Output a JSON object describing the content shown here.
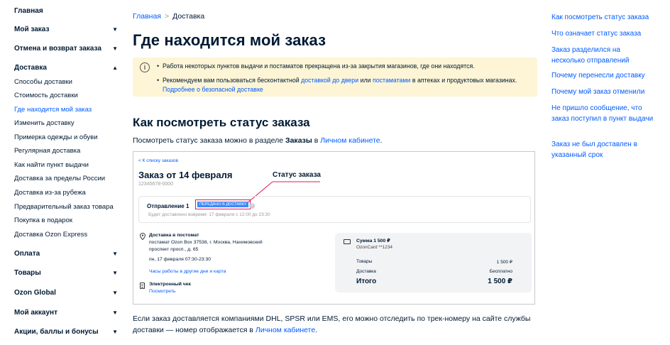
{
  "sidebar": {
    "sections": [
      {
        "label": "Главная",
        "chevron": ""
      },
      {
        "label": "Мой заказ",
        "chevron": "▼"
      },
      {
        "label": "Отмена и возврат заказа",
        "chevron": "▼"
      },
      {
        "label": "Доставка",
        "chevron": "▲"
      },
      {
        "label": "Оплата",
        "chevron": "▼"
      },
      {
        "label": "Товары",
        "chevron": "▼"
      },
      {
        "label": "Ozon Global",
        "chevron": "▼"
      },
      {
        "label": "Мой аккаунт",
        "chevron": "▼"
      },
      {
        "label": "Акции, баллы и бонусы",
        "chevron": "▼"
      }
    ],
    "delivery_items": [
      "Способы доставки",
      "Стоимость доставки",
      "Где находится мой заказ",
      "Изменить доставку",
      "Примерка одежды и обуви",
      "Регулярная доставка",
      "Как найти пункт выдачи",
      "Доставка за пределы России",
      "Доставка из-за рубежа",
      "Предварительный заказ товара",
      "Покупка в подарок",
      "Доставка Ozon Express"
    ]
  },
  "breadcrumb": {
    "home": "Главная",
    "separator": ">",
    "current": "Доставка"
  },
  "page_title": "Где находится мой заказ",
  "notice": {
    "icon": "info-icon",
    "line1": "Работа некоторых пунктов выдачи и постаматов прекращена из-за закрытия магазинов, где они находятся.",
    "line2_pre": "Рекомендуем вам пользоваться бесконтактной ",
    "line2_link1": "доставкой до двери",
    "line2_mid": " или ",
    "line2_link2": "постаматами",
    "line2_post": " в аптеках и продуктовых магазинах.",
    "line3_link": "Подробнее о безопасной доставке"
  },
  "section_title": "Как посмотреть статус заказа",
  "para1": {
    "pre": "Посмотреть статус заказа можно в разделе ",
    "bold": "Заказы",
    "mid": " в ",
    "link": "Личном кабинете",
    "post": "."
  },
  "screenshot": {
    "back": "< К списку заказов",
    "order_title": "Заказ от 14 февраля",
    "order_number": "12345678-0000",
    "annotation": "Статус заказа",
    "shipment_label": "Отправление 1",
    "status_badge": "ПЕРЕДАНО В ДОСТАВКУ",
    "help": "?",
    "delivery_time": "Будет доставлено вовремя: 17 февраля с 12:00 до 23:30",
    "address_title": "Доставка в постомат",
    "address_line1": "постамат Ozon Box 37538, г. Москва, Нахимовский",
    "address_line2": "проспект просп., д. 65",
    "address_line3": "пн, 17 февраля      07:30-23:30",
    "hours_link": "Часы работы в другие дни и карта",
    "receipt_title": "Электронный чек",
    "receipt_link": "Посмотреть",
    "sum_title": "Сумма 1 500 ₽",
    "card": "OzonCard **1234",
    "rows": [
      {
        "label": "Товары",
        "value": "1 500 ₽"
      },
      {
        "label": "Доставка",
        "value": "Бесплатно"
      }
    ],
    "total_label": "Итого",
    "total_value": "1 500 ₽"
  },
  "para2": {
    "pre": "Если заказ доставляется компаниями DHL, SPSR или EMS, его можно отследить по трек-номеру на сайте службы доставки — номер отображается в ",
    "link": "Личном кабинете",
    "post": "."
  },
  "toc": [
    "Как посмотреть статус заказа",
    "Что означает статус заказа",
    "Заказ разделился на несколько отправлений",
    "Почему перенесли доставку",
    "Почему мой заказ отменили",
    "Не пришло сообщение, что заказ поступил в пункт выдачи",
    "Заказ не был доставлен в указанный срок"
  ],
  "colors": {
    "link": "#005bff",
    "notice_bg": "#fdf5d5",
    "badge": "#3d8af7",
    "annotation": "#e6185f"
  }
}
